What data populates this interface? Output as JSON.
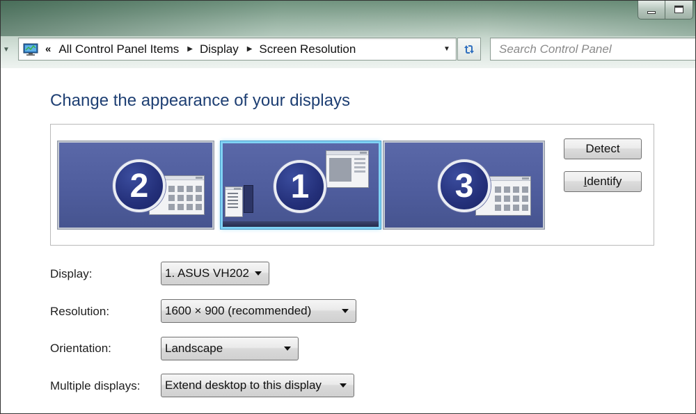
{
  "address_bar": {
    "lead_separator": "«",
    "breadcrumbs": [
      "All Control Panel Items",
      "Display",
      "Screen Resolution"
    ]
  },
  "search": {
    "placeholder": "Search Control Panel"
  },
  "page": {
    "heading": "Change the appearance of your displays"
  },
  "monitors": [
    {
      "number": "2",
      "selected": false
    },
    {
      "number": "1",
      "selected": true
    },
    {
      "number": "3",
      "selected": false
    }
  ],
  "buttons": {
    "detect": "Detect",
    "identify_mnemonic": "I",
    "identify_rest": "dentify"
  },
  "settings": {
    "display": {
      "label": "Display:",
      "value": "1. ASUS VH202"
    },
    "resolution": {
      "label": "Resolution:",
      "value": "1600 × 900 (recommended)"
    },
    "orientation": {
      "label": "Orientation:",
      "value": "Landscape"
    },
    "multiple_displays": {
      "label": "Multiple displays:",
      "value": "Extend desktop to this display"
    }
  },
  "colors": {
    "heading": "#1e3f73",
    "monitor_fill": "#4e5c9c",
    "selected_border": "#7fd2f4"
  }
}
